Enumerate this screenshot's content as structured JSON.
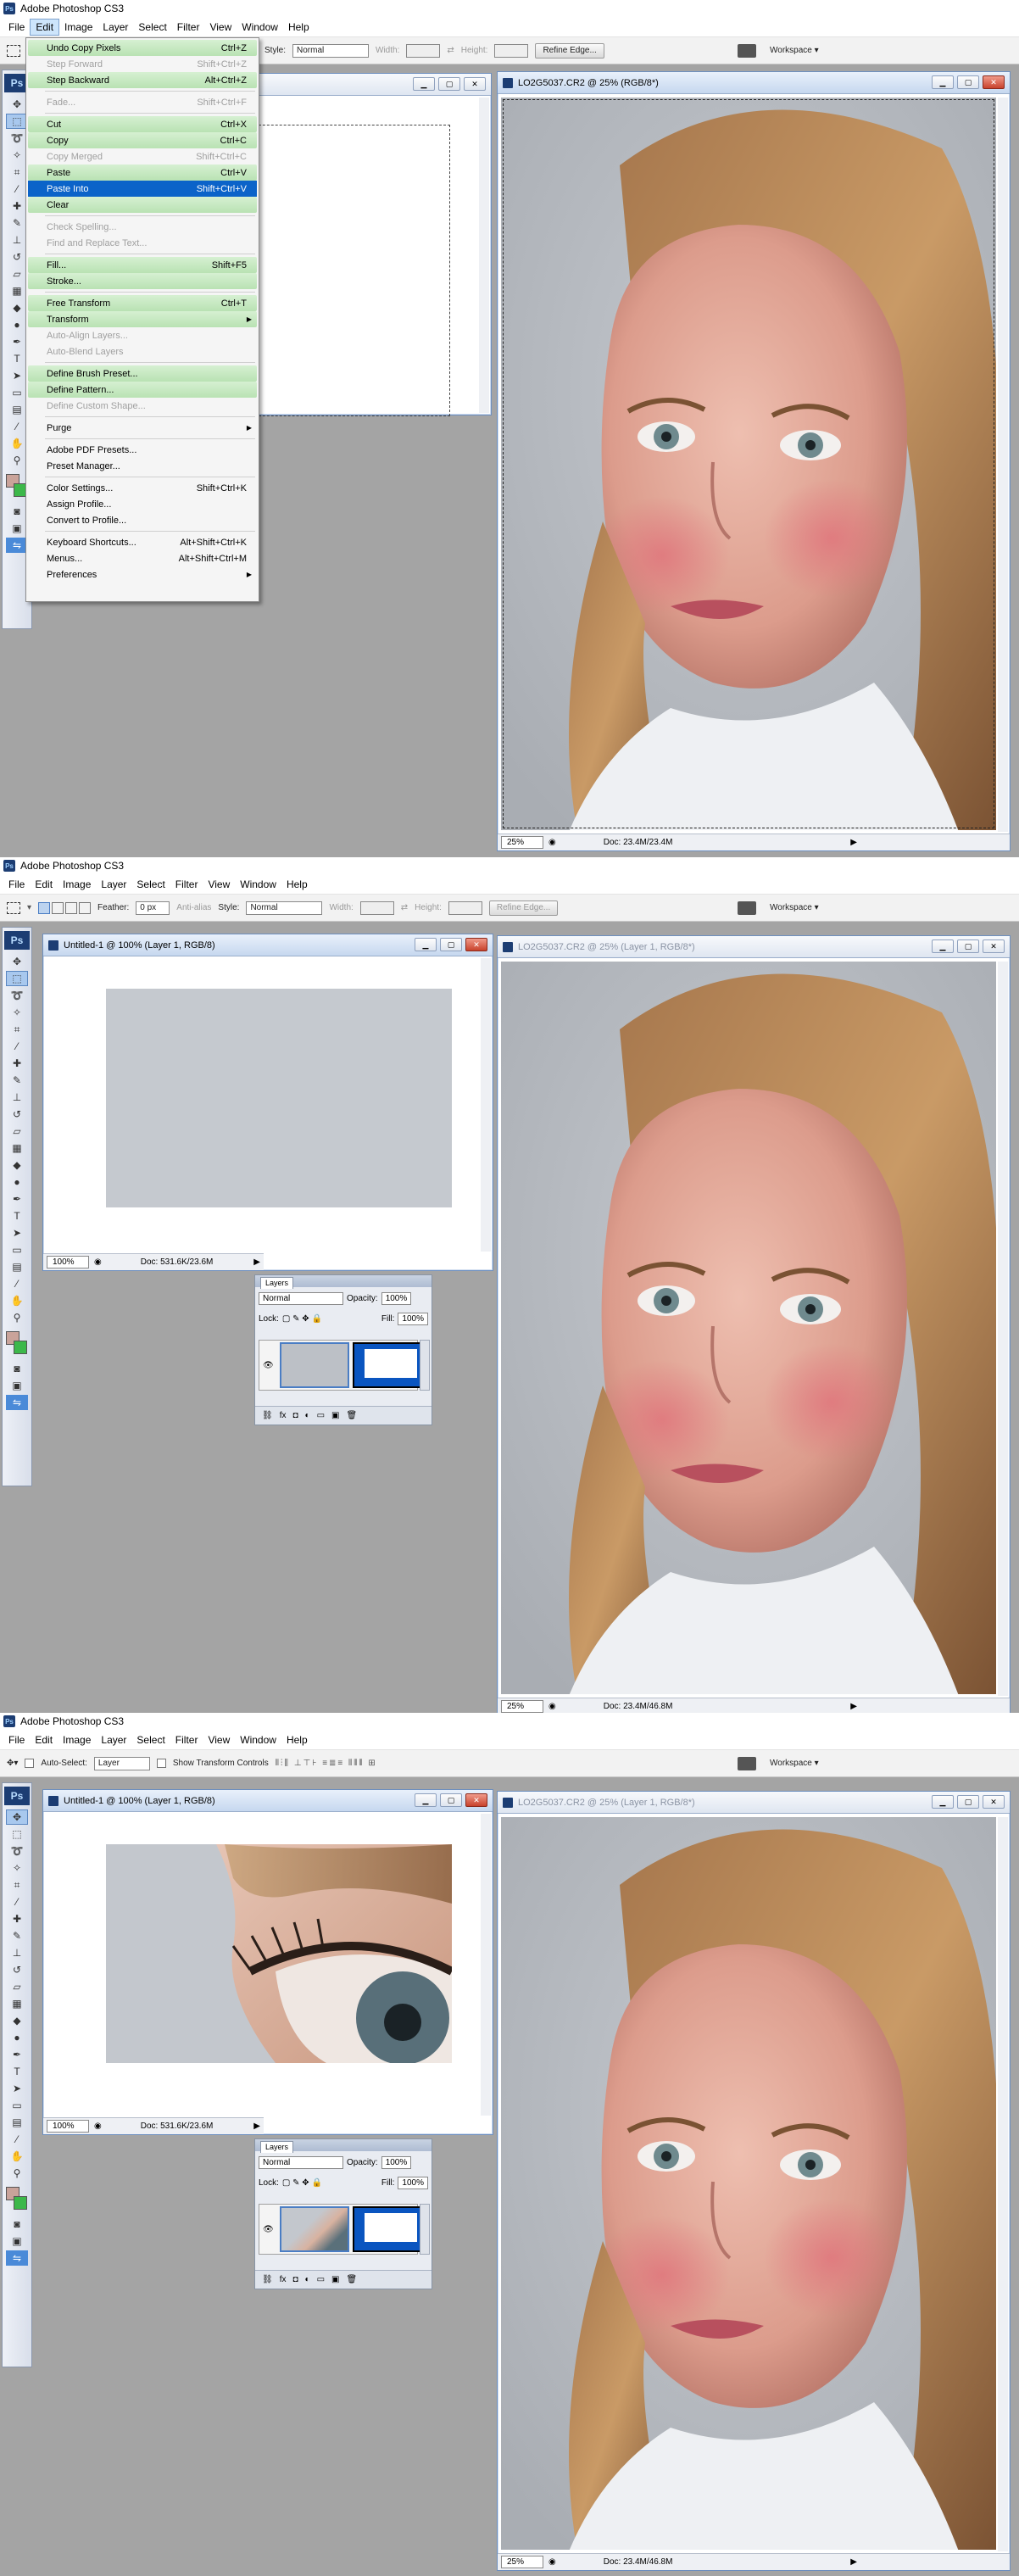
{
  "app": {
    "title": "Adobe Photoshop CS3",
    "logo": "Ps"
  },
  "menubar": [
    "File",
    "Edit",
    "Image",
    "Layer",
    "Select",
    "Filter",
    "View",
    "Window",
    "Help"
  ],
  "options_marquee": {
    "feather_label": "Feather:",
    "feather_value": "0 px",
    "antialias_label": "Anti-alias",
    "style_label": "Style:",
    "style_value": "Normal",
    "width_label": "Width:",
    "height_label": "Height:",
    "refine_edge": "Refine Edge...",
    "workspace": "Workspace ▾"
  },
  "options_move": {
    "auto_select_label": "Auto-Select:",
    "auto_select_value": "Layer",
    "show_transform": "Show Transform Controls",
    "workspace": "Workspace ▾"
  },
  "edit_menu": {
    "items": [
      {
        "label": "Undo Copy Pixels",
        "shortcut": "Ctrl+Z",
        "state": "hl"
      },
      {
        "label": "Step Forward",
        "shortcut": "Shift+Ctrl+Z",
        "state": "dis"
      },
      {
        "label": "Step Backward",
        "shortcut": "Alt+Ctrl+Z",
        "state": "hl"
      },
      {
        "sep": true
      },
      {
        "label": "Fade...",
        "shortcut": "Shift+Ctrl+F",
        "state": "dis"
      },
      {
        "sep": true
      },
      {
        "label": "Cut",
        "shortcut": "Ctrl+X",
        "state": "hl"
      },
      {
        "label": "Copy",
        "shortcut": "Ctrl+C",
        "state": "hl"
      },
      {
        "label": "Copy Merged",
        "shortcut": "Shift+Ctrl+C",
        "state": "dis"
      },
      {
        "label": "Paste",
        "shortcut": "Ctrl+V",
        "state": "hl"
      },
      {
        "label": "Paste Into",
        "shortcut": "Shift+Ctrl+V",
        "state": "sel"
      },
      {
        "label": "Clear",
        "shortcut": "",
        "state": "hl"
      },
      {
        "sep": true
      },
      {
        "label": "Check Spelling...",
        "shortcut": "",
        "state": "dis"
      },
      {
        "label": "Find and Replace Text...",
        "shortcut": "",
        "state": "dis"
      },
      {
        "sep": true
      },
      {
        "label": "Fill...",
        "shortcut": "Shift+F5",
        "state": "hl"
      },
      {
        "label": "Stroke...",
        "shortcut": "",
        "state": "hl"
      },
      {
        "sep": true
      },
      {
        "label": "Free Transform",
        "shortcut": "Ctrl+T",
        "state": "hl"
      },
      {
        "label": "Transform",
        "shortcut": "",
        "state": "hl",
        "sub": true
      },
      {
        "label": "Auto-Align Layers...",
        "shortcut": "",
        "state": "dis"
      },
      {
        "label": "Auto-Blend Layers",
        "shortcut": "",
        "state": "dis"
      },
      {
        "sep": true
      },
      {
        "label": "Define Brush Preset...",
        "shortcut": "",
        "state": "hl"
      },
      {
        "label": "Define Pattern...",
        "shortcut": "",
        "state": "hl"
      },
      {
        "label": "Define Custom Shape...",
        "shortcut": "",
        "state": "dis"
      },
      {
        "sep": true
      },
      {
        "label": "Purge",
        "shortcut": "",
        "state": "",
        "sub": true
      },
      {
        "sep": true
      },
      {
        "label": "Adobe PDF Presets...",
        "shortcut": "",
        "state": ""
      },
      {
        "label": "Preset Manager...",
        "shortcut": "",
        "state": ""
      },
      {
        "sep": true
      },
      {
        "label": "Color Settings...",
        "shortcut": "Shift+Ctrl+K",
        "state": ""
      },
      {
        "label": "Assign Profile...",
        "shortcut": "",
        "state": ""
      },
      {
        "label": "Convert to Profile...",
        "shortcut": "",
        "state": ""
      },
      {
        "sep": true
      },
      {
        "label": "Keyboard Shortcuts...",
        "shortcut": "Alt+Shift+Ctrl+K",
        "state": ""
      },
      {
        "label": "Menus...",
        "shortcut": "Alt+Shift+Ctrl+M",
        "state": ""
      },
      {
        "label": "Preferences",
        "shortcut": "",
        "state": "",
        "sub": true
      }
    ]
  },
  "docs": {
    "untitled_title": "Untitled-1 @ 100% (Layer 1, RGB/8)",
    "untitled_zoom": "100%",
    "untitled_info": "Doc: 531.6K/23.6M",
    "photo_title_1": "LO2G5037.CR2 @ 25% (RGB/8*)",
    "photo_title_2": "LO2G5037.CR2 @ 25% (Layer 1, RGB/8*)",
    "photo_zoom": "25%",
    "photo_info_1": "Doc: 23.4M/23.4M",
    "photo_info_2": "Doc: 23.4M/46.8M"
  },
  "layers_panel": {
    "tab": "Layers",
    "blend": "Normal",
    "opacity_label": "Opacity:",
    "opacity_value": "100%",
    "lock_label": "Lock:",
    "fill_label": "Fill:",
    "fill_value": "100%"
  }
}
